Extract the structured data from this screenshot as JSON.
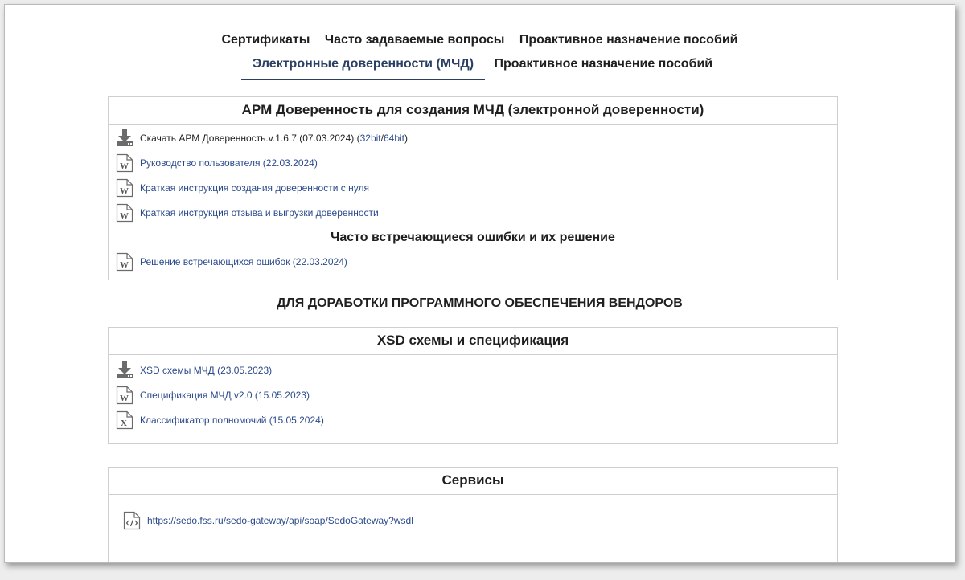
{
  "tabs": {
    "row1": [
      "Сертификаты",
      "Часто задаваемые вопросы",
      "Проактивное назначение пособий"
    ],
    "active": "Электронные доверенности (МЧД)",
    "row2_other": "Проактивное назначение пособий"
  },
  "arm_panel": {
    "title": "АРМ Доверенность для создания МЧД (электронной доверенности)",
    "download": {
      "text": "Скачать АРМ Доверенность.v.1.6.7 (07.03.2024) (",
      "link32": "32bit",
      "sep": " / ",
      "link64": "64bit",
      "close": ")"
    },
    "docs": [
      "Руководство пользователя (22.03.2024)",
      "Краткая инструкция создания доверенности с нуля",
      "Краткая инструкция отзыва и выгрузки доверенности"
    ],
    "errors_title": "Часто встречающиеся ошибки и их решение",
    "errors_doc": "Решение встречающихся ошибок (22.03.2024)"
  },
  "vendors_title": "ДЛЯ ДОРАБОТКИ ПРОГРАММНОГО ОБЕСПЕЧЕНИЯ ВЕНДОРОВ",
  "xsd_panel": {
    "title": "XSD схемы и спецификация",
    "items": [
      "XSD схемы МЧД (23.05.2023)",
      "Спецификация МЧД v2.0 (15.05.2023)",
      "Классификатор полномочий (15.05.2024)"
    ]
  },
  "services_panel": {
    "title": "Сервисы",
    "link": "https://sedo.fss.ru/sedo-gateway/api/soap/SedoGateway?wsdl"
  },
  "icons": [
    "download-icon",
    "word-doc-icon",
    "excel-doc-icon",
    "code-file-icon"
  ],
  "colors": {
    "link": "#2b4a8c",
    "active_tab": "#2b3f63",
    "border": "#cfcfcf"
  }
}
